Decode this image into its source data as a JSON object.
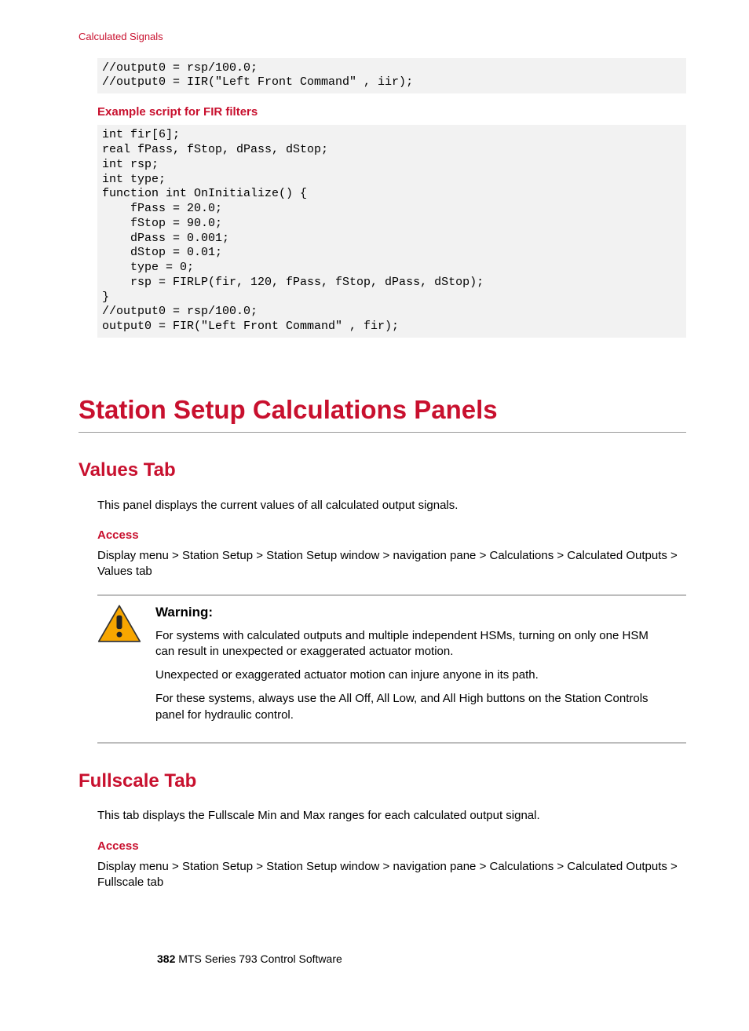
{
  "header": {
    "section_label": "Calculated Signals"
  },
  "codeblock1": "//output0 = rsp/100.0;\n//output0 = IIR(\"Left Front Command\" , iir);",
  "heading_fir": "Example script for FIR filters",
  "codeblock2": "int fir[6];\nreal fPass, fStop, dPass, dStop;\nint rsp;\nint type;\nfunction int OnInitialize() {\n    fPass = 20.0;\n    fStop = 90.0;\n    dPass = 0.001;\n    dStop = 0.01;\n    type = 0;\n    rsp = FIRLP(fir, 120, fPass, fStop, dPass, dStop);\n}\n//output0 = rsp/100.0;\noutput0 = FIR(\"Left Front Command\" , fir);",
  "h1": "Station Setup Calculations Panels",
  "values": {
    "title": "Values Tab",
    "body": "This panel displays the current values of all calculated output signals.",
    "access_label": "Access",
    "access_path": "Display menu > Station Setup > Station Setup window > navigation pane > Calculations > Calculated Outputs > Values tab"
  },
  "warning": {
    "title": "Warning:",
    "p1": "For systems with calculated outputs and multiple independent HSMs, turning on only one HSM can result in unexpected or exaggerated actuator motion.",
    "p2": "Unexpected or exaggerated actuator motion can injure anyone in its path.",
    "p3": "For these systems, always use the All Off, All Low, and All High buttons on the Station Controls panel for hydraulic control."
  },
  "fullscale": {
    "title": "Fullscale Tab",
    "body": "This tab displays the Fullscale Min and Max ranges for each calculated output signal.",
    "access_label": "Access",
    "access_path": "Display menu > Station Setup > Station Setup window > navigation pane > Calculations > Calculated Outputs > Fullscale tab"
  },
  "footer": {
    "page": "382",
    "title": "  MTS Series 793 Control Software"
  }
}
